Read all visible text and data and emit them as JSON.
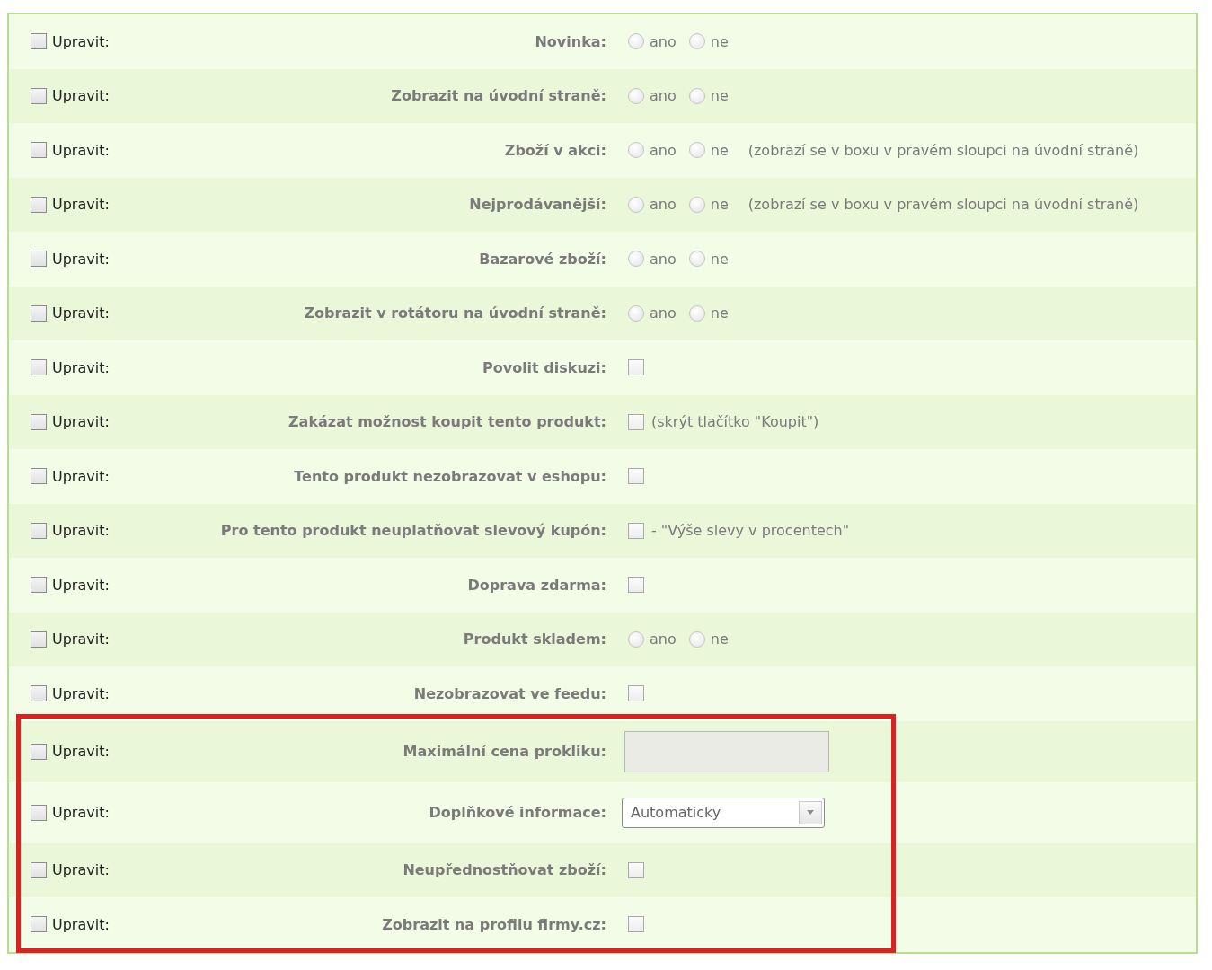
{
  "rows": [
    {
      "edit": {
        "label": "Upravit:",
        "checked": false
      },
      "label": "Novinka:",
      "kind": "radio",
      "options": [
        {
          "label": "ano",
          "selected": false
        },
        {
          "label": "ne",
          "selected": false
        }
      ]
    },
    {
      "edit": {
        "label": "Upravit:",
        "checked": false
      },
      "label": "Zobrazit na úvodní straně:",
      "kind": "radio",
      "options": [
        {
          "label": "ano",
          "selected": false
        },
        {
          "label": "ne",
          "selected": false
        }
      ]
    },
    {
      "edit": {
        "label": "Upravit:",
        "checked": false
      },
      "label": "Zboží v akci:",
      "kind": "radio",
      "options": [
        {
          "label": "ano",
          "selected": false
        },
        {
          "label": "ne",
          "selected": false
        }
      ],
      "note": "(zobrazí se v boxu v pravém sloupci na úvodní straně)"
    },
    {
      "edit": {
        "label": "Upravit:",
        "checked": false
      },
      "label": "Nejprodávanější:",
      "kind": "radio",
      "options": [
        {
          "label": "ano",
          "selected": false
        },
        {
          "label": "ne",
          "selected": false
        }
      ],
      "note": "(zobrazí se v boxu v pravém sloupci na úvodní straně)"
    },
    {
      "edit": {
        "label": "Upravit:",
        "checked": false
      },
      "label": "Bazarové zboží:",
      "kind": "radio",
      "options": [
        {
          "label": "ano",
          "selected": false
        },
        {
          "label": "ne",
          "selected": false
        }
      ]
    },
    {
      "edit": {
        "label": "Upravit:",
        "checked": false
      },
      "label": "Zobrazit v rotátoru na úvodní straně:",
      "kind": "radio",
      "options": [
        {
          "label": "ano",
          "selected": false
        },
        {
          "label": "ne",
          "selected": false
        }
      ]
    },
    {
      "edit": {
        "label": "Upravit:",
        "checked": false
      },
      "label": "Povolit diskuzi:",
      "kind": "checkbox",
      "checked": false
    },
    {
      "edit": {
        "label": "Upravit:",
        "checked": false
      },
      "label": "Zakázat možnost koupit tento produkt:",
      "kind": "checkbox",
      "checked": false,
      "note": "(skrýt tlačítko \"Koupit\")"
    },
    {
      "edit": {
        "label": "Upravit:",
        "checked": false
      },
      "label": "Tento produkt nezobrazovat v eshopu:",
      "kind": "checkbox",
      "checked": false
    },
    {
      "edit": {
        "label": "Upravit:",
        "checked": false
      },
      "label": "Pro tento produkt neuplatňovat slevový kupón:",
      "kind": "checkbox",
      "checked": false,
      "note": "- \"Výše slevy v procentech\""
    },
    {
      "edit": {
        "label": "Upravit:",
        "checked": false
      },
      "label": "Doprava zdarma:",
      "kind": "checkbox",
      "checked": false
    },
    {
      "edit": {
        "label": "Upravit:",
        "checked": false
      },
      "label": "Produkt skladem:",
      "kind": "radio",
      "options": [
        {
          "label": "ano",
          "selected": false
        },
        {
          "label": "ne",
          "selected": false
        }
      ]
    },
    {
      "edit": {
        "label": "Upravit:",
        "checked": false
      },
      "label": "Nezobrazovat ve feedu:",
      "kind": "checkbox",
      "checked": false
    }
  ],
  "highlighted_rows": [
    {
      "edit": {
        "label": "Upravit:",
        "checked": false
      },
      "label": "Maximální cena prokliku:",
      "kind": "text_input",
      "disabled": true
    },
    {
      "edit": {
        "label": "Upravit:",
        "checked": false
      },
      "label": "Doplňkové informace:",
      "kind": "select",
      "value": "Automaticky"
    },
    {
      "edit": {
        "label": "Upravit:",
        "checked": false
      },
      "label": "Neupřednostňovat zboží:",
      "kind": "checkbox",
      "checked": false
    },
    {
      "edit": {
        "label": "Upravit:",
        "checked": false
      },
      "label": "Zobrazit na profilu firmy.cz:",
      "kind": "checkbox",
      "checked": false
    }
  ]
}
